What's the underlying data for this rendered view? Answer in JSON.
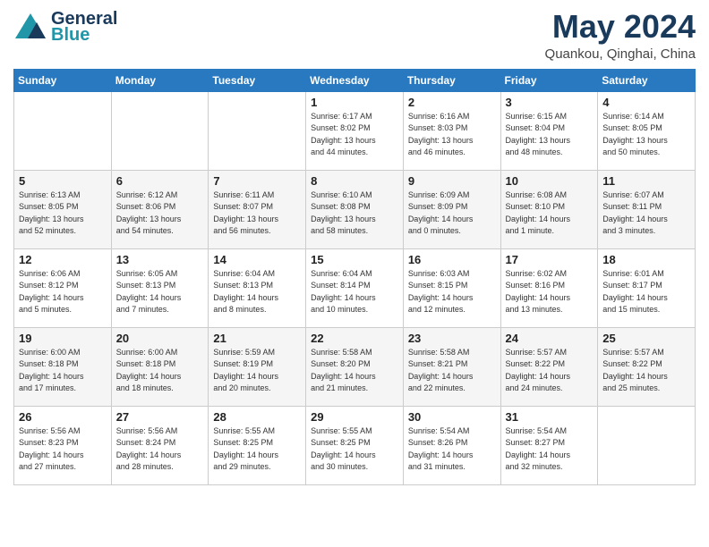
{
  "header": {
    "logo_general": "General",
    "logo_blue": "Blue",
    "month_title": "May 2024",
    "location": "Quankou, Qinghai, China"
  },
  "weekdays": [
    "Sunday",
    "Monday",
    "Tuesday",
    "Wednesday",
    "Thursday",
    "Friday",
    "Saturday"
  ],
  "weeks": [
    {
      "row_class": "row-1",
      "days": [
        {
          "num": "",
          "info": ""
        },
        {
          "num": "",
          "info": ""
        },
        {
          "num": "",
          "info": ""
        },
        {
          "num": "1",
          "info": "Sunrise: 6:17 AM\nSunset: 8:02 PM\nDaylight: 13 hours\nand 44 minutes."
        },
        {
          "num": "2",
          "info": "Sunrise: 6:16 AM\nSunset: 8:03 PM\nDaylight: 13 hours\nand 46 minutes."
        },
        {
          "num": "3",
          "info": "Sunrise: 6:15 AM\nSunset: 8:04 PM\nDaylight: 13 hours\nand 48 minutes."
        },
        {
          "num": "4",
          "info": "Sunrise: 6:14 AM\nSunset: 8:05 PM\nDaylight: 13 hours\nand 50 minutes."
        }
      ]
    },
    {
      "row_class": "row-2",
      "days": [
        {
          "num": "5",
          "info": "Sunrise: 6:13 AM\nSunset: 8:05 PM\nDaylight: 13 hours\nand 52 minutes."
        },
        {
          "num": "6",
          "info": "Sunrise: 6:12 AM\nSunset: 8:06 PM\nDaylight: 13 hours\nand 54 minutes."
        },
        {
          "num": "7",
          "info": "Sunrise: 6:11 AM\nSunset: 8:07 PM\nDaylight: 13 hours\nand 56 minutes."
        },
        {
          "num": "8",
          "info": "Sunrise: 6:10 AM\nSunset: 8:08 PM\nDaylight: 13 hours\nand 58 minutes."
        },
        {
          "num": "9",
          "info": "Sunrise: 6:09 AM\nSunset: 8:09 PM\nDaylight: 14 hours\nand 0 minutes."
        },
        {
          "num": "10",
          "info": "Sunrise: 6:08 AM\nSunset: 8:10 PM\nDaylight: 14 hours\nand 1 minute."
        },
        {
          "num": "11",
          "info": "Sunrise: 6:07 AM\nSunset: 8:11 PM\nDaylight: 14 hours\nand 3 minutes."
        }
      ]
    },
    {
      "row_class": "row-3",
      "days": [
        {
          "num": "12",
          "info": "Sunrise: 6:06 AM\nSunset: 8:12 PM\nDaylight: 14 hours\nand 5 minutes."
        },
        {
          "num": "13",
          "info": "Sunrise: 6:05 AM\nSunset: 8:13 PM\nDaylight: 14 hours\nand 7 minutes."
        },
        {
          "num": "14",
          "info": "Sunrise: 6:04 AM\nSunset: 8:13 PM\nDaylight: 14 hours\nand 8 minutes."
        },
        {
          "num": "15",
          "info": "Sunrise: 6:04 AM\nSunset: 8:14 PM\nDaylight: 14 hours\nand 10 minutes."
        },
        {
          "num": "16",
          "info": "Sunrise: 6:03 AM\nSunset: 8:15 PM\nDaylight: 14 hours\nand 12 minutes."
        },
        {
          "num": "17",
          "info": "Sunrise: 6:02 AM\nSunset: 8:16 PM\nDaylight: 14 hours\nand 13 minutes."
        },
        {
          "num": "18",
          "info": "Sunrise: 6:01 AM\nSunset: 8:17 PM\nDaylight: 14 hours\nand 15 minutes."
        }
      ]
    },
    {
      "row_class": "row-4",
      "days": [
        {
          "num": "19",
          "info": "Sunrise: 6:00 AM\nSunset: 8:18 PM\nDaylight: 14 hours\nand 17 minutes."
        },
        {
          "num": "20",
          "info": "Sunrise: 6:00 AM\nSunset: 8:18 PM\nDaylight: 14 hours\nand 18 minutes."
        },
        {
          "num": "21",
          "info": "Sunrise: 5:59 AM\nSunset: 8:19 PM\nDaylight: 14 hours\nand 20 minutes."
        },
        {
          "num": "22",
          "info": "Sunrise: 5:58 AM\nSunset: 8:20 PM\nDaylight: 14 hours\nand 21 minutes."
        },
        {
          "num": "23",
          "info": "Sunrise: 5:58 AM\nSunset: 8:21 PM\nDaylight: 14 hours\nand 22 minutes."
        },
        {
          "num": "24",
          "info": "Sunrise: 5:57 AM\nSunset: 8:22 PM\nDaylight: 14 hours\nand 24 minutes."
        },
        {
          "num": "25",
          "info": "Sunrise: 5:57 AM\nSunset: 8:22 PM\nDaylight: 14 hours\nand 25 minutes."
        }
      ]
    },
    {
      "row_class": "row-5",
      "days": [
        {
          "num": "26",
          "info": "Sunrise: 5:56 AM\nSunset: 8:23 PM\nDaylight: 14 hours\nand 27 minutes."
        },
        {
          "num": "27",
          "info": "Sunrise: 5:56 AM\nSunset: 8:24 PM\nDaylight: 14 hours\nand 28 minutes."
        },
        {
          "num": "28",
          "info": "Sunrise: 5:55 AM\nSunset: 8:25 PM\nDaylight: 14 hours\nand 29 minutes."
        },
        {
          "num": "29",
          "info": "Sunrise: 5:55 AM\nSunset: 8:25 PM\nDaylight: 14 hours\nand 30 minutes."
        },
        {
          "num": "30",
          "info": "Sunrise: 5:54 AM\nSunset: 8:26 PM\nDaylight: 14 hours\nand 31 minutes."
        },
        {
          "num": "31",
          "info": "Sunrise: 5:54 AM\nSunset: 8:27 PM\nDaylight: 14 hours\nand 32 minutes."
        },
        {
          "num": "",
          "info": ""
        }
      ]
    }
  ]
}
